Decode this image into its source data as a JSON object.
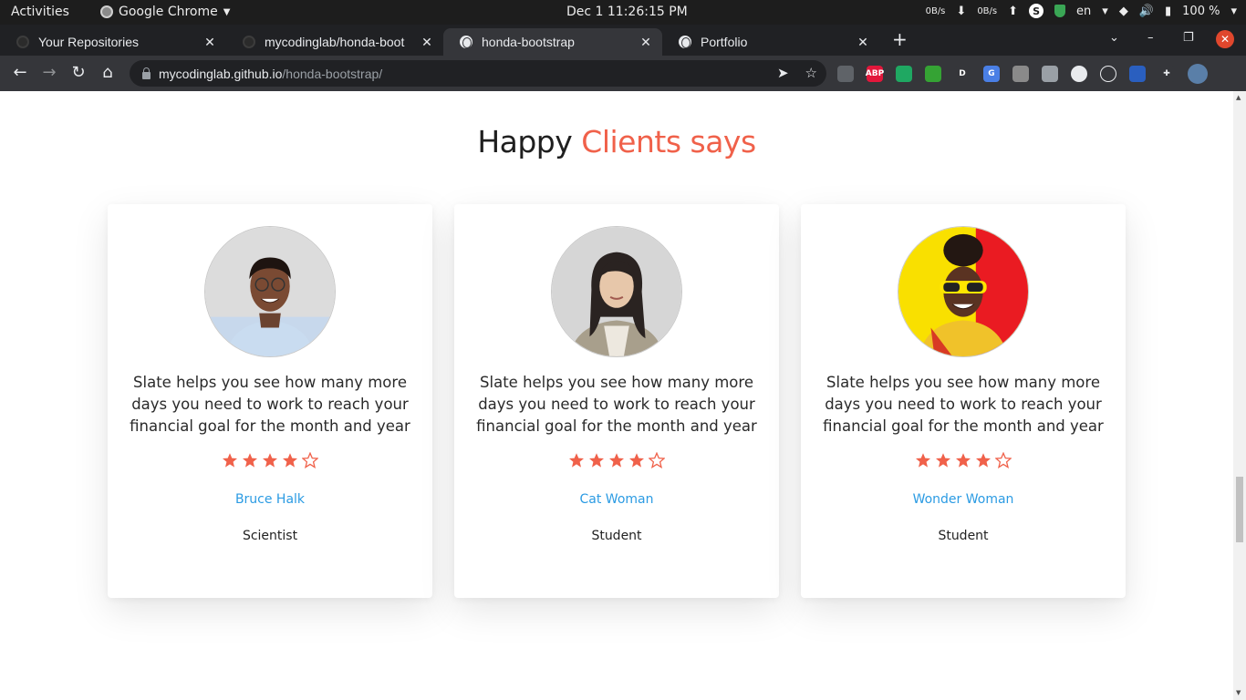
{
  "system_bar": {
    "activities": "Activities",
    "app_name": "Google Chrome",
    "clock": "Dec 1  11:26:15 PM",
    "net_down": "0B/s",
    "net_up": "0B/s",
    "language": "en",
    "battery": "100 %"
  },
  "tabs": [
    {
      "label": "Your Repositories",
      "favicon": "github-icon"
    },
    {
      "label": "mycodinglab/honda-boot",
      "favicon": "github-icon"
    },
    {
      "label": "honda-bootstrap",
      "favicon": "globe-icon",
      "active": true
    },
    {
      "label": "Portfolio",
      "favicon": "globe-icon"
    }
  ],
  "address_bar": {
    "host": "mycodinglab.github.io",
    "path": "/honda-bootstrap/"
  },
  "extensions": [
    {
      "name": "mail-icon",
      "color": "#5f6368",
      "text": ""
    },
    {
      "name": "adblock-icon",
      "color": "#e2173b",
      "text": "ABP"
    },
    {
      "name": "shield-check-icon",
      "color": "#1fa862",
      "text": ""
    },
    {
      "name": "download-arrow-icon",
      "color": "#35a334",
      "text": ""
    },
    {
      "name": "script-d-icon",
      "color": "#35363a",
      "text": "D"
    },
    {
      "name": "translate-icon",
      "color": "#4a7fe5",
      "text": "G"
    },
    {
      "name": "translate-x-icon",
      "color": "#8a8a8a",
      "text": ""
    },
    {
      "name": "touch-icon",
      "color": "#9aa0a6",
      "text": ""
    },
    {
      "name": "code-icon",
      "color": "#e8eaed",
      "text": ""
    },
    {
      "name": "react-icon",
      "color": "#35363a",
      "text": ""
    },
    {
      "name": "flag-icon",
      "color": "#2a5fbf",
      "text": ""
    },
    {
      "name": "puzzle-icon",
      "color": "#35363a",
      "text": ""
    }
  ],
  "section": {
    "title_part1": "Happy",
    "title_part2": "Clients says",
    "accent_color": "#f0614a",
    "link_color": "#2b9be3"
  },
  "testimonials": [
    {
      "quote": "Slate helps you see how many more days you need to work to reach your financial goal for the month and year",
      "rating": 4,
      "max_rating": 5,
      "name": "Bruce Halk",
      "role": "Scientist"
    },
    {
      "quote": "Slate helps you see how many more days you need to work to reach your financial goal for the month and year",
      "rating": 4,
      "max_rating": 5,
      "name": "Cat Woman",
      "role": "Student"
    },
    {
      "quote": "Slate helps you see how many more days you need to work to reach your financial goal for the month and year",
      "rating": 4,
      "max_rating": 5,
      "name": "Wonder Woman",
      "role": "Student"
    }
  ],
  "scroll": {
    "position": 0.72
  }
}
